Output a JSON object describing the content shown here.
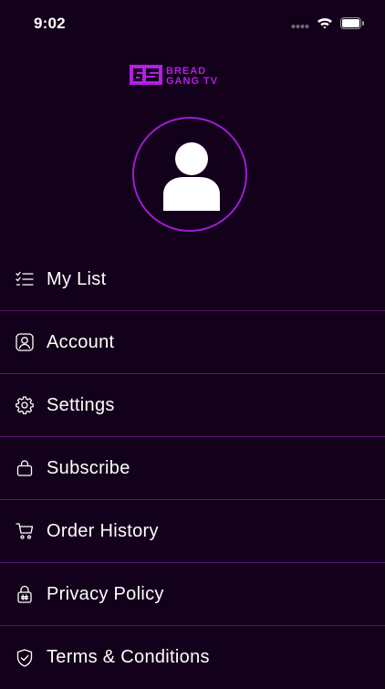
{
  "status": {
    "time": "9:02"
  },
  "brand": {
    "line1": "BREAD",
    "line2": "GANG TV",
    "color": "#b41ee6"
  },
  "menu": [
    {
      "label": "My List",
      "icon": "checklist-icon"
    },
    {
      "label": "Account",
      "icon": "user-square-icon"
    },
    {
      "label": "Settings",
      "icon": "gear-icon"
    },
    {
      "label": "Subscribe",
      "icon": "shopping-bag-icon"
    },
    {
      "label": "Order History",
      "icon": "cart-icon"
    },
    {
      "label": "Privacy Policy",
      "icon": "lock-icon"
    },
    {
      "label": "Terms & Conditions",
      "icon": "shield-check-icon"
    }
  ],
  "colors": {
    "background": "#13001a",
    "accent": "#a21ad6",
    "divider": "#5a1478"
  }
}
